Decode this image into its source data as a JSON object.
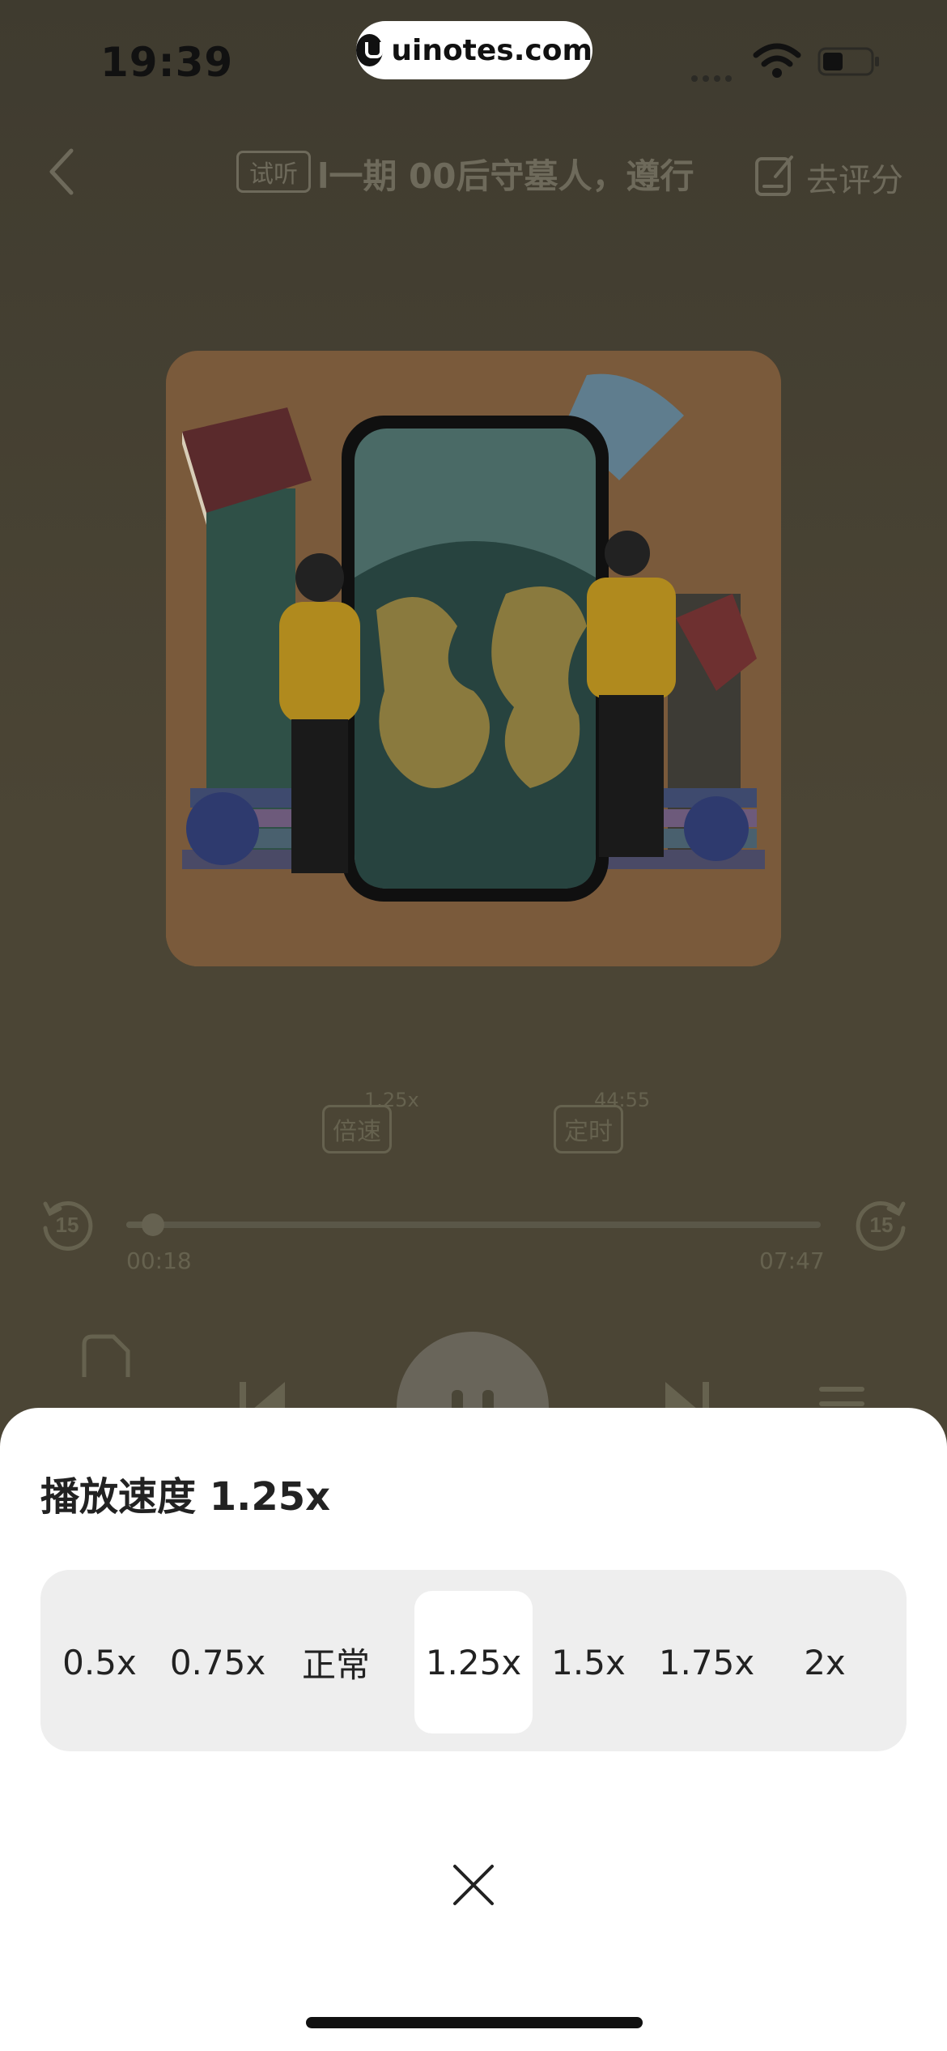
{
  "status_bar": {
    "time": "19:39"
  },
  "watermark": {
    "text": "uinotes.com"
  },
  "header": {
    "badge": "试听",
    "title": "l一期 00后守墓人，遵行",
    "rate_label": "去评分"
  },
  "player": {
    "speed": {
      "label": "倍速",
      "value": "1.25x"
    },
    "timer": {
      "label": "定时",
      "value": "44:55"
    },
    "skip_seconds": "15",
    "elapsed": "00:18",
    "duration": "07:47",
    "progress_fraction": 0.039
  },
  "speed_sheet": {
    "title": "播放速度 1.25x",
    "options": [
      "0.5x",
      "0.75x",
      "正常",
      "1.25x",
      "1.5x",
      "1.75x",
      "2x"
    ],
    "selected_index": 3
  }
}
